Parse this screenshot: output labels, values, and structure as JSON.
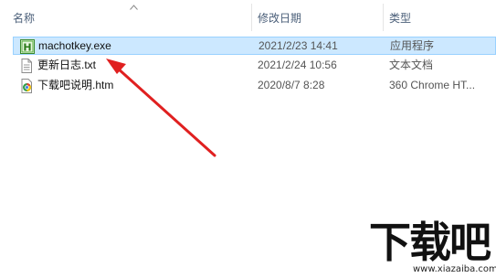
{
  "columns": {
    "name": "名称",
    "date": "修改日期",
    "type": "类型"
  },
  "files": [
    {
      "name": "machotkey.exe",
      "date": "2021/2/23 14:41",
      "type": "应用程序",
      "icon": "exe-icon",
      "selected": true
    },
    {
      "name": "更新日志.txt",
      "date": "2021/2/24 10:56",
      "type": "文本文档",
      "icon": "text-file-icon",
      "selected": false
    },
    {
      "name": "下载吧说明.htm",
      "date": "2020/8/7 8:28",
      "type": "360 Chrome HT...",
      "icon": "chrome-html-icon",
      "selected": false
    }
  ],
  "watermark": {
    "text": "下载吧",
    "url": "www.xiazaiba.com"
  },
  "colors": {
    "selection": "#cce8ff",
    "selection_border": "#99d1ff",
    "annotation_arrow": "#e02020"
  }
}
